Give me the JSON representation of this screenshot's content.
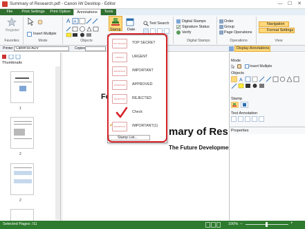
{
  "window": {
    "title": "Summary of Research.pdf - Canon iW Desktop - Editor",
    "min_glyph": "—",
    "max_glyph": "☐",
    "close_glyph": "✕"
  },
  "tabs": [
    "File",
    "Print Settings",
    "Print Option",
    "Annotations",
    "Tools"
  ],
  "active_tab_index": 3,
  "ribbon": {
    "register_label": "Register",
    "insert_multiple_label": "Insert Multiple",
    "stamp_label": "Stamp",
    "date_label": "Date",
    "text_search_label": "Text Search",
    "digital_stamps_label": "Digital Stamps",
    "signature_status_label": "Signature Status",
    "verify_label": "Verify",
    "order_label": "Order",
    "group_label": "Group",
    "page_operations_label": "Page Operations",
    "navigation_label": "Navigation",
    "format_settings_label": "Format Settings",
    "groups": {
      "favorites": "Favorites",
      "mode": "Mode",
      "objects": "Objects",
      "digital_stamps": "Digital Stamps",
      "operations": "Operations",
      "view": "View"
    }
  },
  "toolbar2": {
    "printer_label": "Printer",
    "printer_value": "Canon iR-ADV",
    "copies_label": "Copies",
    "display_annotations_label": "Display Annotations"
  },
  "left_pane": {
    "title": "Thumbnails",
    "page_numbers": [
      "1",
      "2",
      "2"
    ]
  },
  "document": {
    "fragment_fo": "Fo",
    "heading": "mary of Res",
    "subheading": "The Future Development of “DE LA"
  },
  "stamp_menu": {
    "items": [
      {
        "label": "TOP SECRET",
        "stamp_text": "TOP SECRET"
      },
      {
        "label": "URGENT",
        "stamp_text": "URGENT"
      },
      {
        "label": "IMPORTANT",
        "stamp_text": "IMPORTANT"
      },
      {
        "label": "APPROVED",
        "stamp_text": "APPROVED"
      },
      {
        "label": "REJECTED",
        "stamp_text": "REJECTED"
      },
      {
        "label": "Check",
        "stamp_text": ""
      },
      {
        "label": "IMPORTANT(1)",
        "stamp_text": "IMPORTANT"
      }
    ],
    "stamp_list_label": "Stamp List...",
    "checked_index": 6,
    "highlight_color": "#d8232a",
    "check_color": "#d8232a"
  },
  "right_pane": {
    "mode_label": "Mode",
    "insert_multiple_label": "Insert Multiple",
    "objects_label": "Objects",
    "stamp_label": "Stamp",
    "text_annotation_label": "Text Annotation",
    "properties_label": "Properties"
  },
  "status": {
    "selected_pages": "Selected Pages: /11",
    "zoom": "100%"
  },
  "colors": {
    "tab_green": "#2f6f2f",
    "status_green": "#2e7a2e"
  }
}
